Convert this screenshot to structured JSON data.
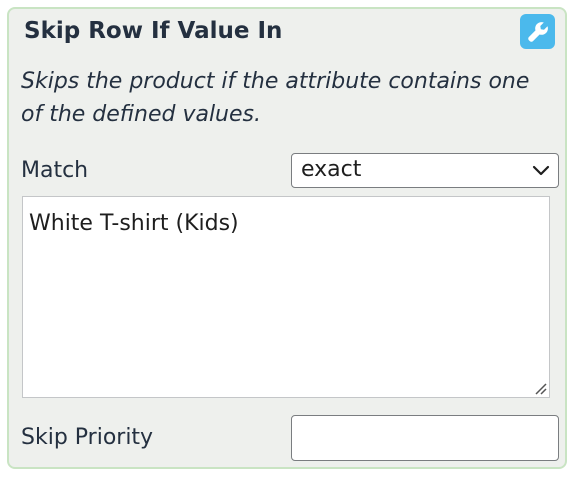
{
  "panel": {
    "title": "Skip Row If Value In",
    "settings_icon": "wrench-icon",
    "description": "Skips the product if the attribute contains one of the defined values.",
    "accent_color": "#4bb9ec",
    "border_color": "#c9e4c3"
  },
  "match": {
    "label": "Match",
    "selected": "exact",
    "icon": "chevron-down-icon"
  },
  "values_textarea": {
    "value": "White T-shirt (Kids)"
  },
  "skip_priority": {
    "label": "Skip Priority",
    "value": ""
  }
}
